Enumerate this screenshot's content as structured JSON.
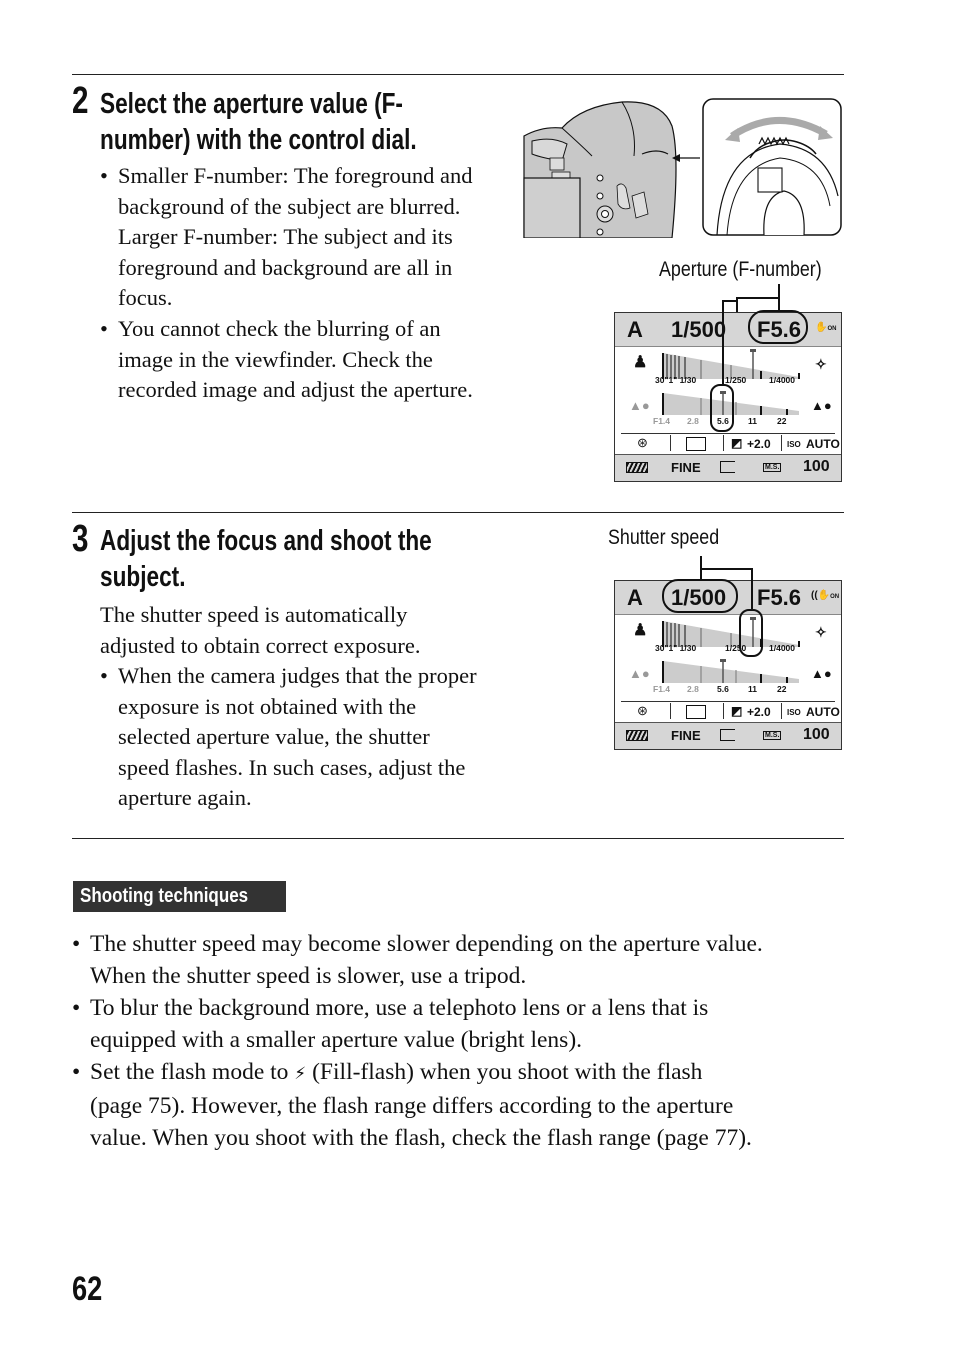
{
  "step2": {
    "number": "2",
    "title_line1": "Select the aperture value (F-",
    "title_line2": "number) with the control dial.",
    "bullets": [
      [
        "Smaller F-number: The foreground and",
        "background of the subject are blurred.",
        "Larger F-number: The subject and its",
        "foreground and background are all in",
        "focus."
      ],
      [
        "You cannot check the blurring of an",
        "image in the viewfinder. Check the",
        "recorded image and adjust the aperture."
      ]
    ],
    "callout": "Aperture (F-number)"
  },
  "step3": {
    "number": "3",
    "title_line1": "Adjust the focus and shoot the",
    "title_line2": "subject.",
    "intro": [
      "The shutter speed is automatically",
      "adjusted to obtain correct exposure."
    ],
    "bullets": [
      [
        "When the camera judges that the proper",
        "exposure is not obtained with the",
        "selected aperture value, the shutter",
        "speed flashes. In such cases, adjust the",
        "aperture again."
      ]
    ],
    "callout": "Shutter speed"
  },
  "lcd": {
    "mode": "A",
    "shutter": "1/500",
    "aperture": "F5.6",
    "steadyshot": "ON",
    "shutter_scale": [
      "30\"",
      "1\"",
      "1/30",
      "1/250",
      "1/4000"
    ],
    "aperture_scale": [
      "F1.4",
      "2.8",
      "5.6",
      "11",
      "22"
    ],
    "exposure_comp": "+2.0",
    "iso_label": "ISO",
    "iso": "AUTO",
    "quality": "FINE",
    "metering": "M.S.",
    "shots_remaining": "100"
  },
  "techniques": {
    "heading": "Shooting techniques",
    "bullets": [
      [
        "The shutter speed may become slower depending on the aperture value.",
        "When the shutter speed is slower, use a tripod."
      ],
      [
        "To blur the background more, use a telephoto lens or a lens that is",
        "equipped with a smaller aperture value (bright lens)."
      ],
      [
        "Set the flash mode to",
        "(Fill-flash) when you shoot with the flash",
        "(page 75). However, the flash range differs according to the aperture",
        "value. When you shoot with the flash, check the flash range (page 77)."
      ]
    ]
  },
  "page_number": "62"
}
